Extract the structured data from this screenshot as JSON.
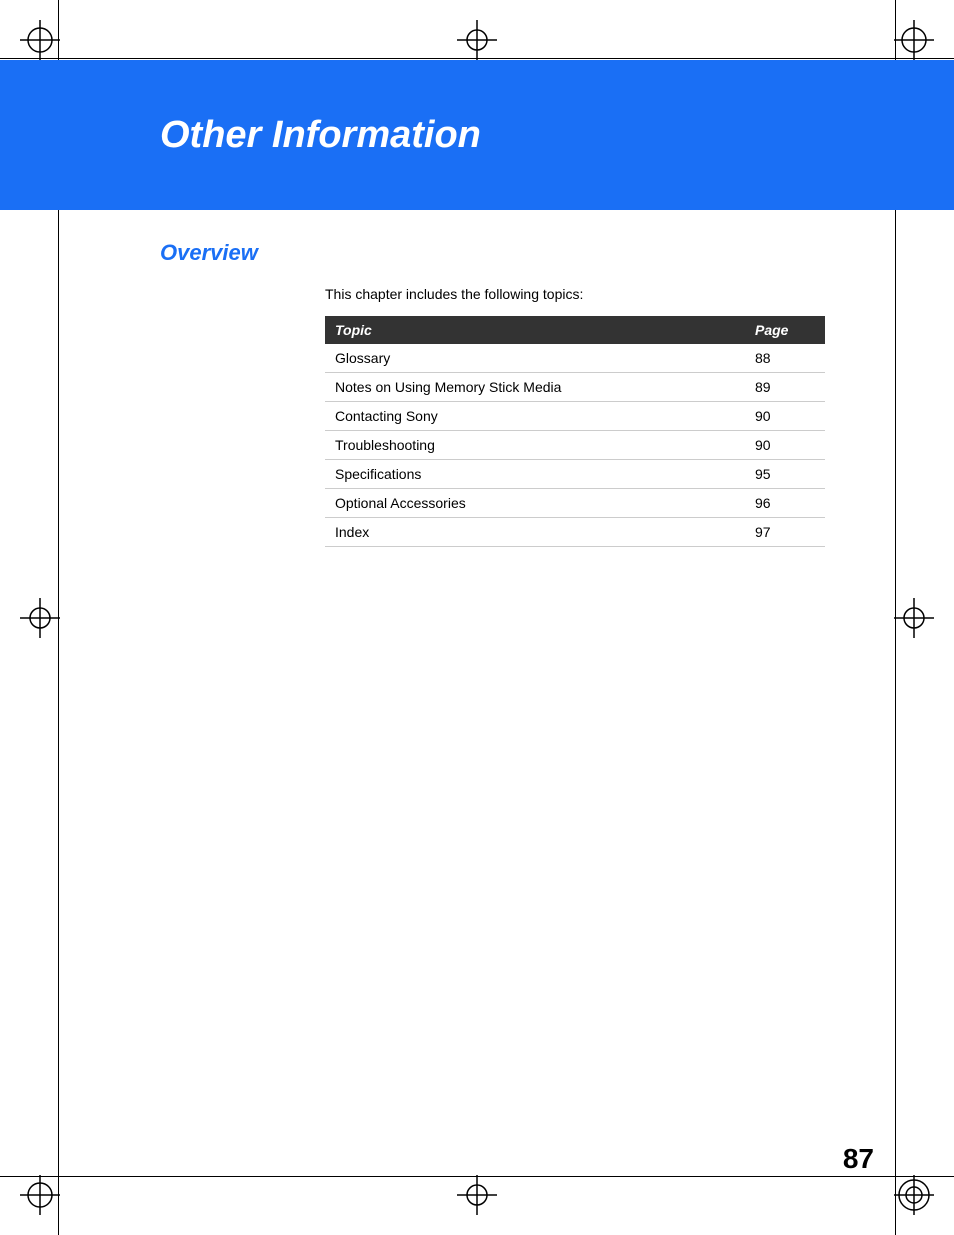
{
  "header": {
    "title": "Other Information",
    "background_color": "#1a6ff5"
  },
  "section": {
    "heading": "Overview",
    "intro_text": "This chapter includes the following topics:"
  },
  "table": {
    "columns": [
      {
        "label": "Topic",
        "key": "topic"
      },
      {
        "label": "Page",
        "key": "page"
      }
    ],
    "rows": [
      {
        "topic": "Glossary",
        "page": "88"
      },
      {
        "topic": "Notes on Using Memory Stick Media",
        "page": "89"
      },
      {
        "topic": "Contacting Sony",
        "page": "90"
      },
      {
        "topic": "Troubleshooting",
        "page": "90"
      },
      {
        "topic": "Specifications",
        "page": "95"
      },
      {
        "topic": "Optional Accessories",
        "page": "96"
      },
      {
        "topic": "Index",
        "page": "97"
      }
    ]
  },
  "page_number": "87",
  "registration_marks": {
    "corners": [
      "top-left",
      "top-right",
      "bottom-left",
      "bottom-right"
    ],
    "midpoints": [
      "top-center",
      "bottom-center",
      "mid-left",
      "mid-right"
    ]
  }
}
